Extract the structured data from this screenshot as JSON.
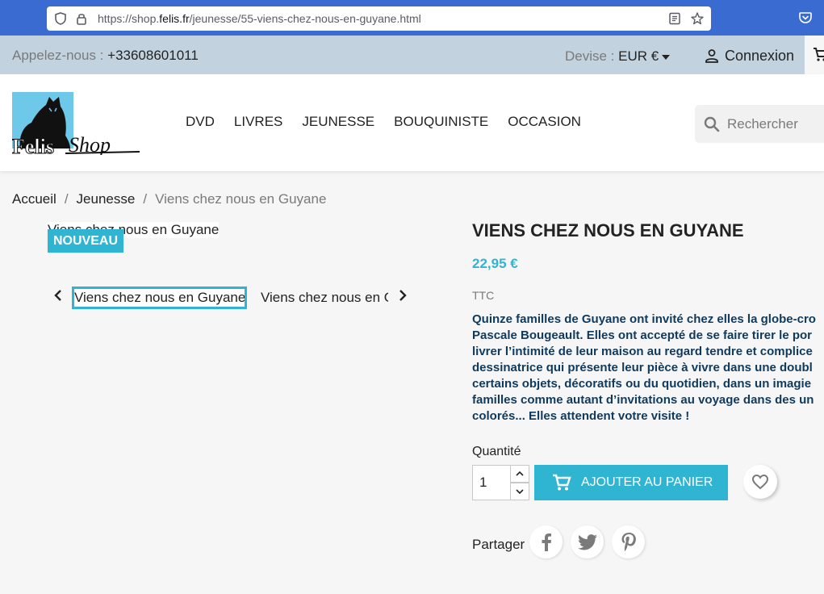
{
  "browser": {
    "url_prefix": "https://shop.",
    "url_domain": "felis.fr",
    "url_path": "/jeunesse/55-viens-chez-nous-en-guyane.html"
  },
  "top_nav": {
    "call_label": "Appelez-nous :",
    "phone": "+33608601011",
    "currency_label": "Devise :",
    "currency_value": "EUR €",
    "login_label": "Connexion"
  },
  "header": {
    "logo_text": "FelisShop",
    "menu": [
      "DVD",
      "LIVRES",
      "JEUNESSE",
      "BOUQUINISTE",
      "OCCASION"
    ],
    "search_placeholder": "Rechercher"
  },
  "breadcrumb": {
    "items": [
      "Accueil",
      "Jeunesse",
      "Viens chez nous en Guyane"
    ],
    "separator": "/"
  },
  "images": {
    "cover_alt": "Viens chez nous en Guyane",
    "badge": "NOUVEAU",
    "thumb_1": "Viens chez nous en Guyane",
    "thumb_2": "Viens chez nous en Guyane"
  },
  "product": {
    "title": "VIENS CHEZ NOUS EN GUYANE",
    "price": "22,95 €",
    "tax_label": "TTC",
    "description_lines": [
      "Quinze familles de Guyane ont invité chez elles la globe-cro",
      "Pascale Bougeault. Elles ont accepté de se faire tirer le por",
      "livrer l’intimité de leur maison au regard tendre et complice",
      "dessinatrice qui présente leur pièce à vivre dans une doubl",
      "certains objets, décoratifs ou du quotidien, dans un imagie",
      "familles comme autant d’invitations au voyage dans des un",
      "colorés... Elles attendent votre visite !"
    ],
    "quantity_label": "Quantité",
    "quantity_value": "1",
    "add_to_cart_label": "Ajouter au panier",
    "share_label": "Partager"
  },
  "colors": {
    "accent": "#2fb5d2",
    "topbar": "#c2d3df",
    "browser": "#3a6bd0"
  },
  "icons": [
    "shield-icon",
    "lock-icon",
    "reader-icon",
    "star-icon",
    "pocket-icon",
    "user-icon",
    "cart-icon",
    "search-icon",
    "chevron-left-icon",
    "chevron-right-icon",
    "heart-icon",
    "facebook-icon",
    "twitter-icon",
    "pinterest-icon"
  ]
}
